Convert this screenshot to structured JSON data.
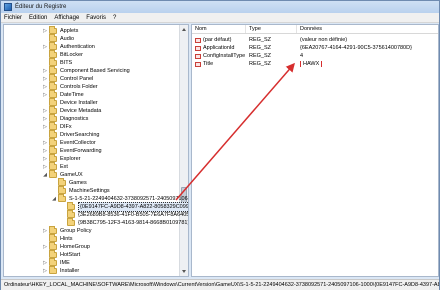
{
  "window": {
    "title": "Éditeur du Registre"
  },
  "menu": [
    "Fichier",
    "Edition",
    "Affichage",
    "Favoris",
    "?"
  ],
  "tree": {
    "items": [
      {
        "label": "Applets",
        "level": 0,
        "expand": "▷"
      },
      {
        "label": "Audio",
        "level": 0,
        "expand": ""
      },
      {
        "label": "Authentication",
        "level": 0,
        "expand": "▷"
      },
      {
        "label": "BitLocker",
        "level": 0,
        "expand": ""
      },
      {
        "label": "BITS",
        "level": 0,
        "expand": ""
      },
      {
        "label": "Component Based Servicing",
        "level": 0,
        "expand": "▷"
      },
      {
        "label": "Control Panel",
        "level": 0,
        "expand": "▷"
      },
      {
        "label": "Controls Folder",
        "level": 0,
        "expand": "▷"
      },
      {
        "label": "DateTime",
        "level": 0,
        "expand": "▷"
      },
      {
        "label": "Device Installer",
        "level": 0,
        "expand": ""
      },
      {
        "label": "Device Metadata",
        "level": 0,
        "expand": "▷"
      },
      {
        "label": "Diagnostics",
        "level": 0,
        "expand": "▷"
      },
      {
        "label": "DIFx",
        "level": 0,
        "expand": "▷"
      },
      {
        "label": "DriverSearching",
        "level": 0,
        "expand": ""
      },
      {
        "label": "EventCollector",
        "level": 0,
        "expand": "▷"
      },
      {
        "label": "EventForwarding",
        "level": 0,
        "expand": "▷"
      },
      {
        "label": "Explorer",
        "level": 0,
        "expand": "▷"
      },
      {
        "label": "Ext",
        "level": 0,
        "expand": "▷"
      },
      {
        "label": "GameUX",
        "level": 0,
        "expand": "◢"
      },
      {
        "label": "Games",
        "level": 1,
        "expand": ""
      },
      {
        "label": "MachineSettings",
        "level": 1,
        "expand": ""
      },
      {
        "label": "S-1-5-21-2249404632-3738092571-2405097106-1000",
        "level": 1,
        "expand": "◢"
      },
      {
        "label": "{0E9147FC-A9D8-4397-A822-8058329C0991}",
        "level": 2,
        "expand": "",
        "selected": true
      },
      {
        "label": "{3E2689B8-8536-41F0-B505-7E6A7F8A6405}",
        "level": 2,
        "expand": ""
      },
      {
        "label": "{9B38C795-12F3-4163-9814-8668B0109781}",
        "level": 2,
        "expand": ""
      },
      {
        "label": "Group Policy",
        "level": 0,
        "expand": "▷"
      },
      {
        "label": "Hints",
        "level": 0,
        "expand": ""
      },
      {
        "label": "HomeGroup",
        "level": 0,
        "expand": "▷"
      },
      {
        "label": "HotStart",
        "level": 0,
        "expand": ""
      },
      {
        "label": "IME",
        "level": 0,
        "expand": "▷"
      },
      {
        "label": "Installer",
        "level": 0,
        "expand": "▷"
      }
    ]
  },
  "values": {
    "headers": [
      "Nom",
      "Type",
      "Données"
    ],
    "rows": [
      {
        "name": "(par défaut)",
        "type": "REG_SZ",
        "data": "(valeur non définie)"
      },
      {
        "name": "ApplicationId",
        "type": "REG_SZ",
        "data": "{6EA20767-4164-4291-90C5-37561400780D}"
      },
      {
        "name": "ConfigInstallType",
        "type": "REG_SZ",
        "data": "4"
      },
      {
        "name": "Title",
        "type": "REG_SZ",
        "data": "HAWX",
        "highlight": true
      }
    ]
  },
  "statusbar": {
    "path": "Ordinateur\\HKEY_LOCAL_MACHINE\\SOFTWARE\\Microsoft\\Windows\\CurrentVersion\\GameUX\\S-1-5-21-2249404632-3738092571-2405097106-1000\\{0E9147FC-A9D8-4397-A822-8058329C0991}"
  },
  "colors": {
    "annotation": "#d62e2e",
    "folder": "#f3d27a"
  }
}
